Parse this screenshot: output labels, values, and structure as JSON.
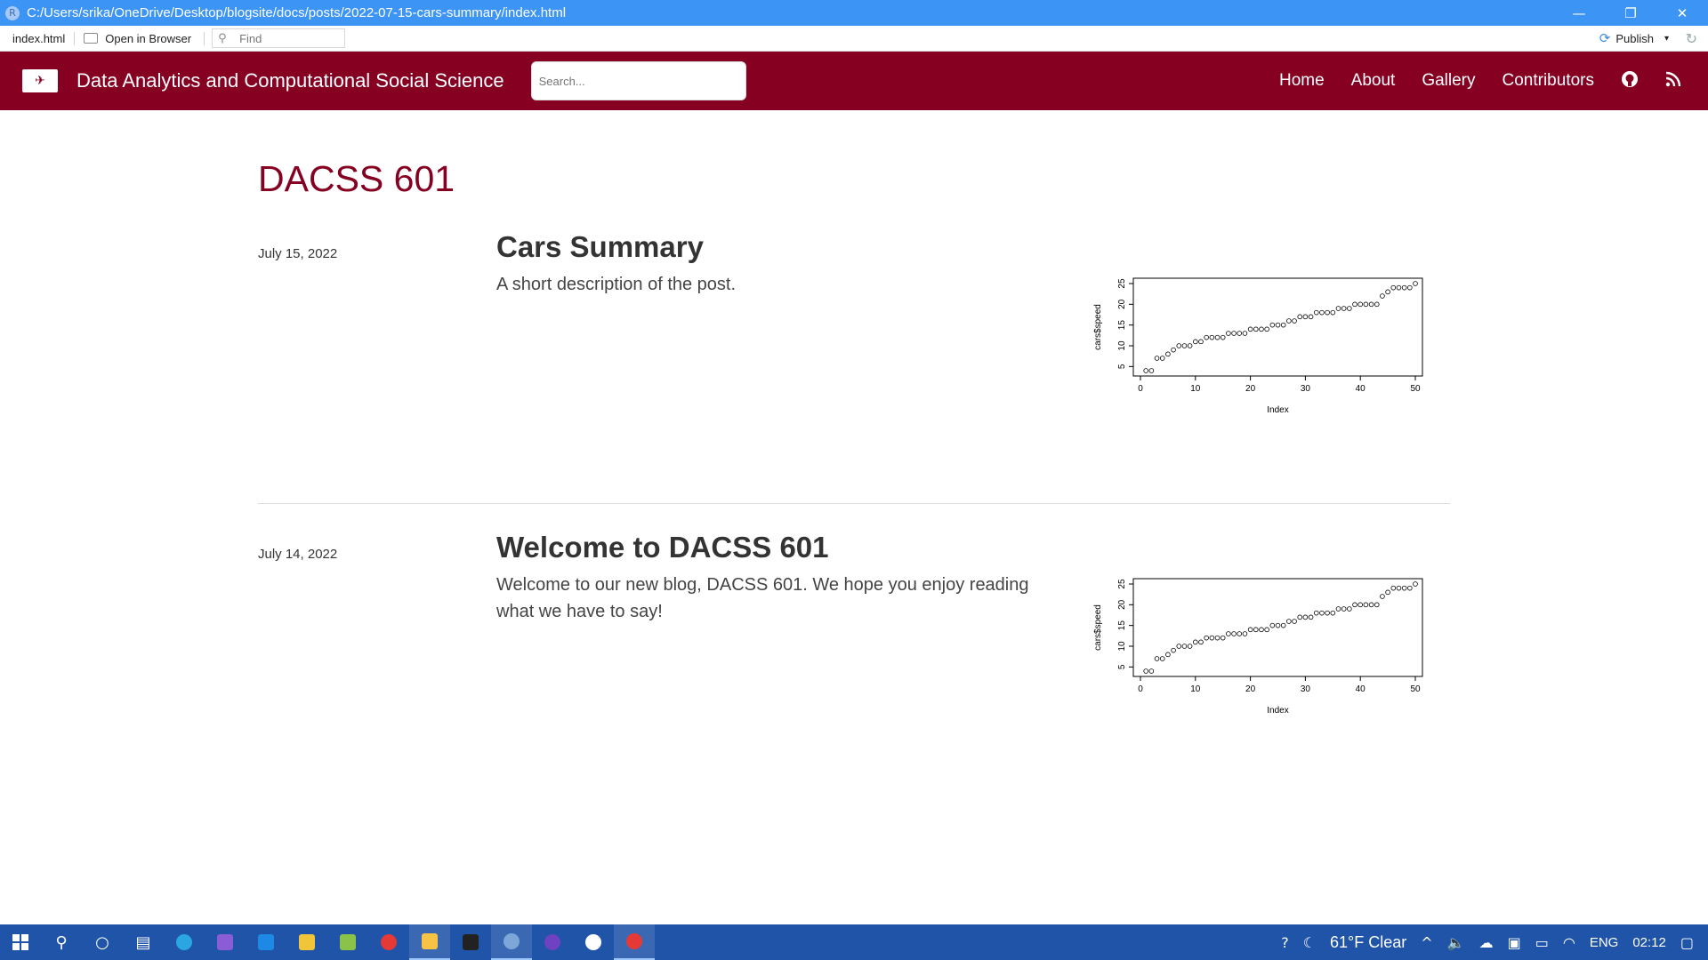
{
  "window": {
    "title": "C:/Users/srika/OneDrive/Desktop/blogsite/docs/posts/2022-07-15-cars-summary/index.html",
    "app_icon_letter": "R",
    "minimize": "—",
    "restore": "❐",
    "close": "✕"
  },
  "viewer": {
    "filename": "index.html",
    "open_in_browser": "Open in Browser",
    "find_placeholder": "Find",
    "publish": "Publish",
    "publish_caret": "▾",
    "refresh_icon": "↻"
  },
  "navbar": {
    "site_title": "Data Analytics and Computational Social Science",
    "search_placeholder": "Search...",
    "links": [
      "Home",
      "About",
      "Gallery",
      "Contributors"
    ],
    "github_icon": "github-icon",
    "rss_icon": "rss-icon",
    "brand_color": "#850021"
  },
  "page": {
    "title": "DACSS 601"
  },
  "posts": [
    {
      "date": "July 15, 2022",
      "title": "Cars Summary",
      "description": "A short description of the post."
    },
    {
      "date": "July 14, 2022",
      "title": "Welcome to DACSS 601",
      "description": "Welcome to our new blog, DACSS 601. We hope you enjoy reading what we have to say!"
    }
  ],
  "chart_data": {
    "type": "scatter",
    "xlabel": "Index",
    "ylabel": "cars$speed",
    "xlim": [
      0,
      50
    ],
    "ylim": [
      4,
      25
    ],
    "x_ticks": [
      "0",
      "10",
      "20",
      "30",
      "40",
      "50"
    ],
    "y_ticks": [
      "5",
      "10",
      "15",
      "20",
      "25"
    ],
    "x": [
      1,
      2,
      3,
      4,
      5,
      6,
      7,
      8,
      9,
      10,
      11,
      12,
      13,
      14,
      15,
      16,
      17,
      18,
      19,
      20,
      21,
      22,
      23,
      24,
      25,
      26,
      27,
      28,
      29,
      30,
      31,
      32,
      33,
      34,
      35,
      36,
      37,
      38,
      39,
      40,
      41,
      42,
      43,
      44,
      45,
      46,
      47,
      48,
      49,
      50
    ],
    "y": [
      4,
      4,
      7,
      7,
      8,
      9,
      10,
      10,
      10,
      11,
      11,
      12,
      12,
      12,
      12,
      13,
      13,
      13,
      13,
      14,
      14,
      14,
      14,
      15,
      15,
      15,
      16,
      16,
      17,
      17,
      17,
      18,
      18,
      18,
      18,
      19,
      19,
      19,
      20,
      20,
      20,
      20,
      20,
      22,
      23,
      24,
      24,
      24,
      24,
      25
    ]
  },
  "taskbar": {
    "weather": "61°F  Clear",
    "language": "ENG",
    "time": "02:12"
  }
}
